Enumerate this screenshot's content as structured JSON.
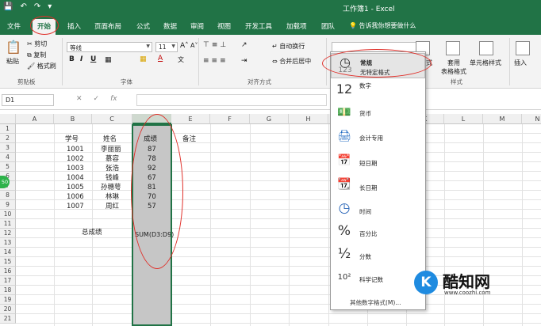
{
  "window": {
    "title": "工作簿1 - Excel"
  },
  "tabs": [
    {
      "label": "文件"
    },
    {
      "label": "开始"
    },
    {
      "label": "插入"
    },
    {
      "label": "页面布局"
    },
    {
      "label": "公式"
    },
    {
      "label": "数据"
    },
    {
      "label": "审阅"
    },
    {
      "label": "视图"
    },
    {
      "label": "开发工具"
    },
    {
      "label": "加载项"
    },
    {
      "label": "团队"
    }
  ],
  "tell_me": "告诉我你想要做什么",
  "ribbon": {
    "paste": "粘贴",
    "cut": "剪切",
    "copy": "复制",
    "format_painter": "格式刷",
    "clipboard_label": "剪贴板",
    "font_name": "等线",
    "font_size": "11",
    "font_label": "字体",
    "wrap_text": "自动换行",
    "merge_center": "合并后居中",
    "alignment_label": "对齐方式",
    "style_fragment": "式",
    "table_format": "套用\n表格格式",
    "cell_styles": "单元格样式",
    "styles_label": "样式",
    "insert": "插入"
  },
  "formula_bar": {
    "name_box": "D1",
    "fx": "fx"
  },
  "columns": [
    "A",
    "B",
    "C",
    "D",
    "E",
    "F",
    "G",
    "H",
    "I",
    "J",
    "K",
    "L",
    "M",
    "N"
  ],
  "rows": [
    "1",
    "2",
    "3",
    "4",
    "5",
    "6",
    "7",
    "8",
    "9",
    "10",
    "11",
    "12",
    "13",
    "14",
    "15",
    "16",
    "17",
    "18",
    "19",
    "20",
    "21"
  ],
  "sheet": {
    "headers": {
      "id": "学号",
      "name": "姓名",
      "score": "成绩",
      "note": "备注"
    },
    "records": [
      {
        "id": "1001",
        "name": "李丽丽",
        "score": "87"
      },
      {
        "id": "1002",
        "name": "慕容",
        "score": "78"
      },
      {
        "id": "1003",
        "name": "张浩",
        "score": "92"
      },
      {
        "id": "1004",
        "name": "钱峰",
        "score": "67"
      },
      {
        "id": "1005",
        "name": "孙穗萼",
        "score": "81"
      },
      {
        "id": "1006",
        "name": "林琳",
        "score": "70"
      },
      {
        "id": "1007",
        "name": "周红",
        "score": "57"
      }
    ],
    "total_label": "总成绩",
    "total_formula": "SUM(D3:D9)"
  },
  "number_format_menu": {
    "items": [
      {
        "icon": "123",
        "label": "常规",
        "sub": "无特定格式"
      },
      {
        "icon": "12",
        "label": "数字"
      },
      {
        "icon": "currency-icon",
        "label": "货币"
      },
      {
        "icon": "accounting-icon",
        "label": "会计专用"
      },
      {
        "icon": "short-date-icon",
        "label": "短日期"
      },
      {
        "icon": "long-date-icon",
        "label": "长日期"
      },
      {
        "icon": "clock-icon",
        "label": "时间"
      },
      {
        "icon": "%",
        "label": "百分比"
      },
      {
        "icon": "½",
        "label": "分数"
      },
      {
        "icon": "10²",
        "label": "科学记数"
      }
    ],
    "more": "其他数字格式(M)..."
  },
  "badge": "50",
  "watermark": {
    "brand": "酷知网",
    "url": "www.coozhi.com"
  },
  "colors": {
    "accent": "#217346",
    "annotation": "#e0302a"
  }
}
